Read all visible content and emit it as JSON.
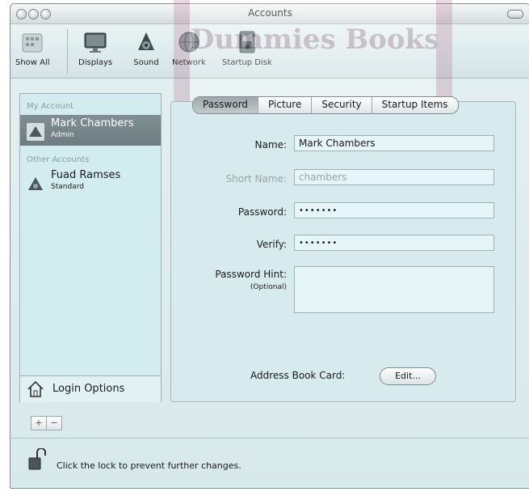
{
  "window": {
    "title": "Accounts"
  },
  "toolbar": {
    "show_all": "Show All",
    "items": [
      "Displays",
      "Sound",
      "Network",
      "Startup Disk"
    ]
  },
  "sidebar": {
    "my_account_header": "My Account",
    "my_account": {
      "name": "Mark Chambers",
      "role": "Admin"
    },
    "other_accounts_header": "Other Accounts",
    "other_accounts": [
      {
        "name": "Fuad Ramses",
        "role": "Standard"
      }
    ],
    "login_options": "Login Options",
    "add": "+",
    "remove": "−"
  },
  "tabs": [
    "Password",
    "Picture",
    "Security",
    "Startup Items"
  ],
  "form": {
    "name_label": "Name:",
    "name_value": "Mark Chambers",
    "short_name_label": "Short Name:",
    "short_name_value": "chambers",
    "password_label": "Password:",
    "password_value": "•••••••",
    "verify_label": "Verify:",
    "verify_value": "•••••••",
    "hint_label": "Password Hint:",
    "hint_optional": "(Optional)",
    "hint_value": ""
  },
  "address_book": {
    "label": "Address Book Card:",
    "button": "Edit..."
  },
  "footer": {
    "lock_text": "Click the lock to prevent further changes."
  },
  "watermark": {
    "text": "Dummies Books"
  }
}
